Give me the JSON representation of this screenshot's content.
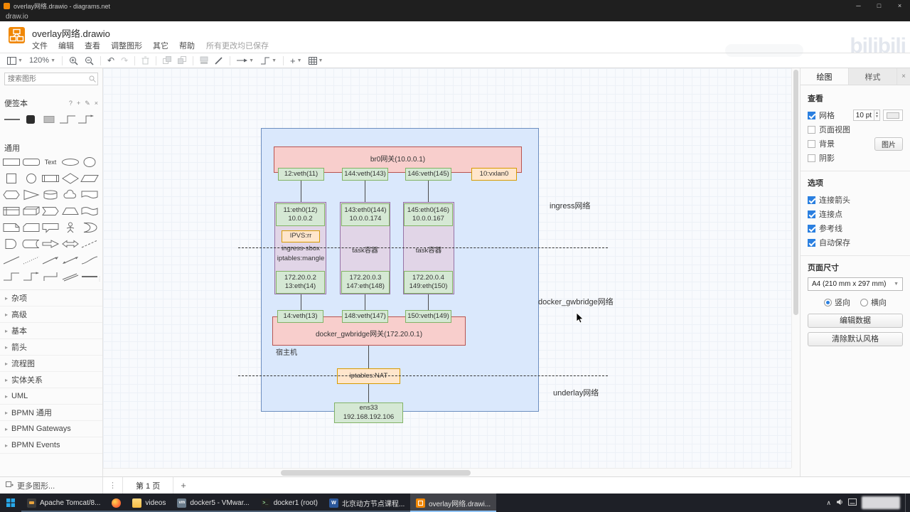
{
  "colors": {
    "accent_blue": "#2a7fe0",
    "drawio_brand_orange": "#f08705",
    "node_green_fill": "#d5e8d4",
    "node_green_border": "#82b366",
    "node_red_fill": "#f8cecc",
    "node_red_border": "#b85450",
    "node_orange_fill": "#ffe6cc",
    "node_orange_border": "#d79b00",
    "node_purple_fill": "#e1d5e7",
    "node_purple_border": "#9673a6",
    "container_blue_fill": "#dae8fc",
    "container_blue_border": "#6c8ebf"
  },
  "titlebar": {
    "window_title": "overlay网络.drawio - diagrams.net",
    "app_menu": "draw.io"
  },
  "header": {
    "doc_title": "overlay网络.drawio",
    "menus": [
      "文件",
      "编辑",
      "查看",
      "调整图形",
      "其它",
      "帮助"
    ],
    "save_status": "所有更改均已保存",
    "watermark": "bilibili"
  },
  "toolbar": {
    "zoom_value": "120%"
  },
  "sidebar": {
    "search_placeholder": "搜索图形",
    "scratchpad_title": "便签本",
    "general_title": "通用",
    "scratchpad_items": [
      "horizontal-line",
      "black-rounded-square",
      "gray-blob",
      "elbow-connector",
      "elbow-arrow"
    ],
    "shapes": [
      "rectangle",
      "rounded-rectangle",
      "text",
      "ellipse-wide",
      "ellipse",
      "square",
      "circle",
      "process",
      "diamond",
      "parallelogram",
      "hexagon",
      "triangle",
      "cylinder",
      "cloud",
      "document",
      "internal-storage",
      "cube",
      "step",
      "trapezoid",
      "tape",
      "note",
      "card",
      "callout",
      "actor",
      "or",
      "and",
      "data-storage",
      "arrow",
      "bidirectional-arrow",
      "dashed-line",
      "line",
      "dotted-line",
      "line-arrow",
      "line-bidirectional",
      "curve",
      "elbow-connector",
      "elbow-arrow",
      "vertical-elbow",
      "link",
      "horizontal-line"
    ],
    "collapsed_sections": [
      "杂项",
      "高级",
      "基本",
      "箭头",
      "流程图",
      "实体关系",
      "UML",
      "BPMN 通用",
      "BPMN Gateways",
      "BPMN Events"
    ],
    "more_shapes_label": "更多图形..."
  },
  "canvas": {
    "diagram": {
      "br0_gateway": "br0网关(10.0.0.1)",
      "veth_top": [
        "12:veth(11)",
        "144:veth(143)",
        "146:veth(145)"
      ],
      "vxlan": "10:vxlan0",
      "eth0_boxes": [
        [
          "11:eth0(12)",
          "10.0.0.2"
        ],
        [
          "143:eth0(144)",
          "10.0.0.174"
        ],
        [
          "145:eth0(146)",
          "10.0.0.167"
        ]
      ],
      "ipvs": "IPVS:rr",
      "sbox_line1": "ingress-sbox",
      "sbox_line2": "iptables:mangle",
      "task1": "task容器",
      "task2": "task容器",
      "ip_boxes": [
        [
          "172.20.0.2",
          "13:eth(14)"
        ],
        [
          "172.20.0.3",
          "147:eth(148)"
        ],
        [
          "172.20.0.4",
          "149:eth(150)"
        ]
      ],
      "veth_bottom": [
        "14:veth(13)",
        "148:veth(147)",
        "150:veth(149)"
      ],
      "gwbridge_gateway": "docker_gwbridge网关(172.20.0.1)",
      "host_label": "宿主机",
      "nat": "iptables:NAT",
      "ens33_line1": "ens33",
      "ens33_line2": "192.168.192.106",
      "network_labels": {
        "ingress": "ingress网络",
        "gwbridge": "docker_gwbridge网络",
        "underlay": "underlay网络"
      }
    }
  },
  "rightpanel": {
    "tabs": {
      "diagram": "绘图",
      "style": "样式"
    },
    "view_section": "查看",
    "grid_label": "网格",
    "grid_size_value": "10 pt",
    "page_view_label": "页面视图",
    "background_label": "背景",
    "image_button": "图片",
    "shadow_label": "阴影",
    "options_section": "选项",
    "options": [
      "连接箭头",
      "连接点",
      "参考线",
      "自动保存"
    ],
    "paper_section": "页面尺寸",
    "paper_size_value": "A4 (210 mm x 297 mm)",
    "orientation_portrait": "竖向",
    "orientation_landscape": "横向",
    "edit_data_button": "编辑数据",
    "clear_default_style_button": "清除默认风格"
  },
  "statusbar": {
    "page_tab": "第 1 页"
  },
  "taskbar": {
    "items": [
      {
        "label": "Apache Tomcat/8...",
        "icon": "tomcat"
      },
      {
        "label": "",
        "icon": "firefox"
      },
      {
        "label": "videos",
        "icon": "folder"
      },
      {
        "label": "docker5 - VMwar...",
        "icon": "vmware"
      },
      {
        "label": "docker1 (root)",
        "icon": "terminal"
      },
      {
        "label": "北京动方节点课程...",
        "icon": "word"
      },
      {
        "label": "overlay网络.drawi...",
        "icon": "drawio",
        "active": true
      }
    ]
  }
}
